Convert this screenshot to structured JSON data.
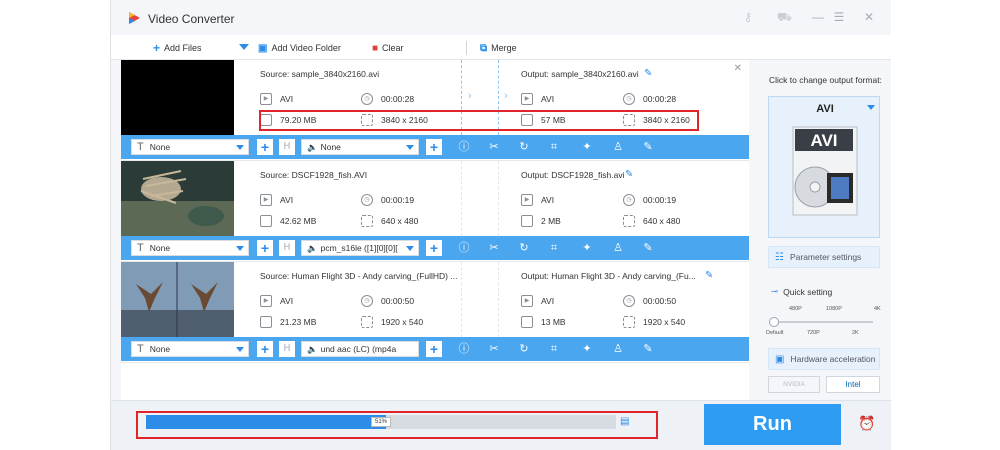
{
  "app": {
    "title": "Video Converter"
  },
  "toolbar": {
    "add_files": "Add Files",
    "add_folder": "Add Video Folder",
    "clear": "Clear",
    "merge": "Merge"
  },
  "items": [
    {
      "source": "Source: sample_3840x2160.avi",
      "output": "Output: sample_3840x2160.avi",
      "src_format": "AVI",
      "src_duration": "00:00:28",
      "src_size": "79.20 MB",
      "src_res": "3840 x 2160",
      "out_format": "AVI",
      "out_duration": "00:00:28",
      "out_size": "57 MB",
      "out_res": "3840 x 2160",
      "subtitle": "None",
      "audio": "None"
    },
    {
      "source": "Source: DSCF1928_fish.AVI",
      "output": "Output: DSCF1928_fish.avi",
      "src_format": "AVI",
      "src_duration": "00:00:19",
      "src_size": "42.62 MB",
      "src_res": "640 x 480",
      "out_format": "AVI",
      "out_duration": "00:00:19",
      "out_size": "2 MB",
      "out_res": "640 x 480",
      "subtitle": "None",
      "audio": "pcm_s16le ([1][0][0]["
    },
    {
      "source": "Source: Human Flight 3D - Andy carving_(FullHD) ...",
      "output": "Output: Human Flight 3D - Andy carving_(Fu...",
      "src_format": "AVI",
      "src_duration": "00:00:50",
      "src_size": "21.23 MB",
      "src_res": "1920 x 540",
      "out_format": "AVI",
      "out_duration": "00:00:50",
      "out_size": "13 MB",
      "out_res": "1920 x 540",
      "subtitle": "None",
      "audio": "und aac (LC) (mp4a"
    }
  ],
  "right": {
    "change_label": "Click to change output format:",
    "format": "AVI",
    "format_badge": "AVI",
    "param": "Parameter settings",
    "quick": "Quick setting",
    "ticks_top": [
      "480P",
      "1080P",
      "4K"
    ],
    "ticks_bottom": [
      "Default",
      "720P",
      "2K"
    ],
    "hw_accel": "Hardware acceleration",
    "nvidia": "NVIDIA",
    "intel": "Intel"
  },
  "progress": {
    "value": 0.51,
    "label": "51%"
  },
  "run": {
    "label": "Run"
  },
  "colors": {
    "accent": "#2d8ce8",
    "bar": "#4aa6ee",
    "highlight": "#e0242a"
  }
}
